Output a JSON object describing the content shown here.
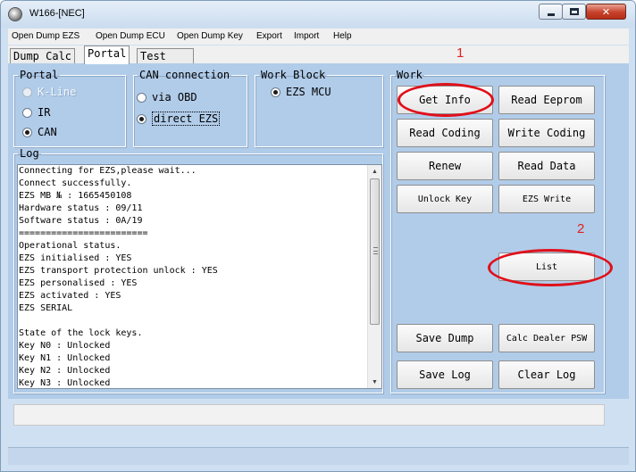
{
  "window": {
    "title": "W166-[NEC]"
  },
  "menu": {
    "items": [
      "Open Dump EZS",
      "Open Dump ECU",
      "Open Dump Key",
      "Export",
      "Import",
      "Help"
    ]
  },
  "tabs": [
    {
      "label": "Dump Calc",
      "active": false
    },
    {
      "label": "Portal",
      "active": true
    },
    {
      "label": "Test",
      "active": false
    }
  ],
  "annotations": {
    "one": "1",
    "two": "2",
    "highlight_color": "#e0101a"
  },
  "portal": {
    "title": "Portal",
    "options": [
      {
        "label": "K-Line",
        "checked": false,
        "disabled": true
      },
      {
        "label": "IR",
        "checked": false,
        "disabled": false
      },
      {
        "label": "CAN",
        "checked": true,
        "disabled": false
      }
    ]
  },
  "can_connection": {
    "title": "CAN connection",
    "options": [
      {
        "label": "via OBD",
        "checked": false
      },
      {
        "label": "direct EZS",
        "checked": true
      }
    ]
  },
  "work_block": {
    "title": "Work Block",
    "options": [
      {
        "label": "EZS MCU",
        "checked": true
      }
    ]
  },
  "log": {
    "title": "Log",
    "text": "Connecting for EZS,please wait...\nConnect successfully.\nEZS MB № : 1665450108\nHardware status : 09/11\nSoftware status : 0A/19\n========================\nOperational status.\nEZS initialised : YES\nEZS transport protection unlock : YES\nEZS personalised : YES\nEZS activated : YES\nEZS SERIAL\n\nState of the lock keys.\nKey N0 : Unlocked\nKey N1 : Unlocked\nKey N2 : Unlocked\nKey N3 : Unlocked"
  },
  "work": {
    "title": "Work",
    "buttons": {
      "get_info": "Get Info",
      "read_eeprom": "Read Eeprom",
      "read_coding": "Read Coding",
      "write_coding": "Write Coding",
      "renew": "Renew",
      "read_data": "Read Data",
      "unlock_key": "Unlock Key",
      "ezs_write": "EZS Write",
      "list": "List",
      "save_dump": "Save Dump",
      "calc_dealer_psw": "Calc Dealer PSW",
      "save_log": "Save Log",
      "clear_log": "Clear Log"
    }
  },
  "colors": {
    "panel": "#b1cce9",
    "window": "#cfe0f2",
    "annotation_red": "#e0101a"
  }
}
